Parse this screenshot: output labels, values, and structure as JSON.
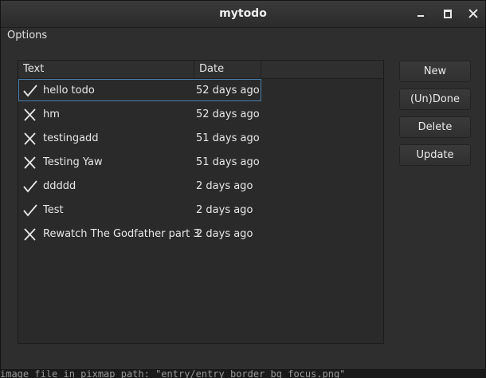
{
  "window": {
    "title": "mytodo"
  },
  "menu": {
    "options_label": "Options"
  },
  "list": {
    "columns": [
      "Text",
      "Date"
    ],
    "rows": [
      {
        "done": true,
        "icon": "check-icon",
        "text": "hello todo",
        "date": "52 days ago",
        "selected": true
      },
      {
        "done": false,
        "icon": "cross-icon",
        "text": "hm",
        "date": "52 days ago"
      },
      {
        "done": false,
        "icon": "cross-icon",
        "text": "testingadd",
        "date": "51 days ago"
      },
      {
        "done": false,
        "icon": "cross-icon",
        "text": "Testing Yaw",
        "date": "51 days ago"
      },
      {
        "done": true,
        "icon": "check-icon",
        "text": "ddddd",
        "date": "2 days ago"
      },
      {
        "done": true,
        "icon": "check-icon",
        "text": "Test",
        "date": "2 days ago"
      },
      {
        "done": false,
        "icon": "cross-icon",
        "text": "Rewatch The Godfather part 3",
        "date": "2 days ago"
      }
    ]
  },
  "buttons": {
    "new": "New",
    "undone": "(Un)Done",
    "delete": "Delete",
    "update": "Update"
  },
  "terminal": {
    "line": "image file in pixmap path: \"entry/entry_border_bg_focus.png\""
  },
  "colors": {
    "selection_border": "#4a7fb0",
    "window_bg": "#2e2e2e"
  }
}
